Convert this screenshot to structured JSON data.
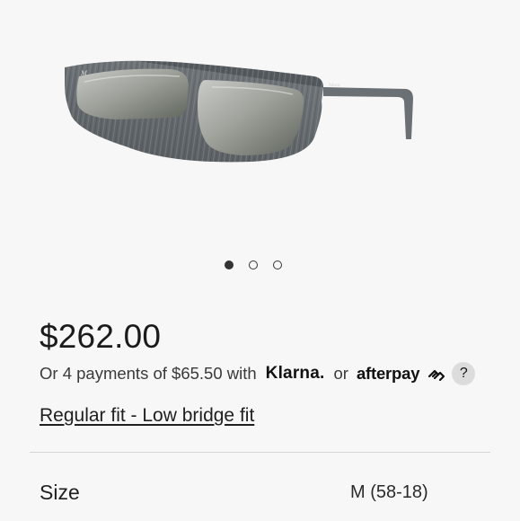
{
  "product": {
    "image_alt": "Grey wood-grain sunglasses with grey mirrored lenses",
    "price": "$262.00",
    "payments": {
      "prefix": "Or 4 payments of $65.50 with",
      "klarna": "Klarna.",
      "or": "or",
      "afterpay": "afterpay",
      "help": "?"
    },
    "fit_link": "Regular fit - Low bridge fit",
    "size": {
      "label": "Size",
      "value": "M (58-18)"
    }
  },
  "carousel": {
    "count": 3,
    "active_index": 0
  },
  "colors": {
    "background": "#f7f7f7",
    "text": "#1f1f1f",
    "divider": "#d4d4d4"
  }
}
